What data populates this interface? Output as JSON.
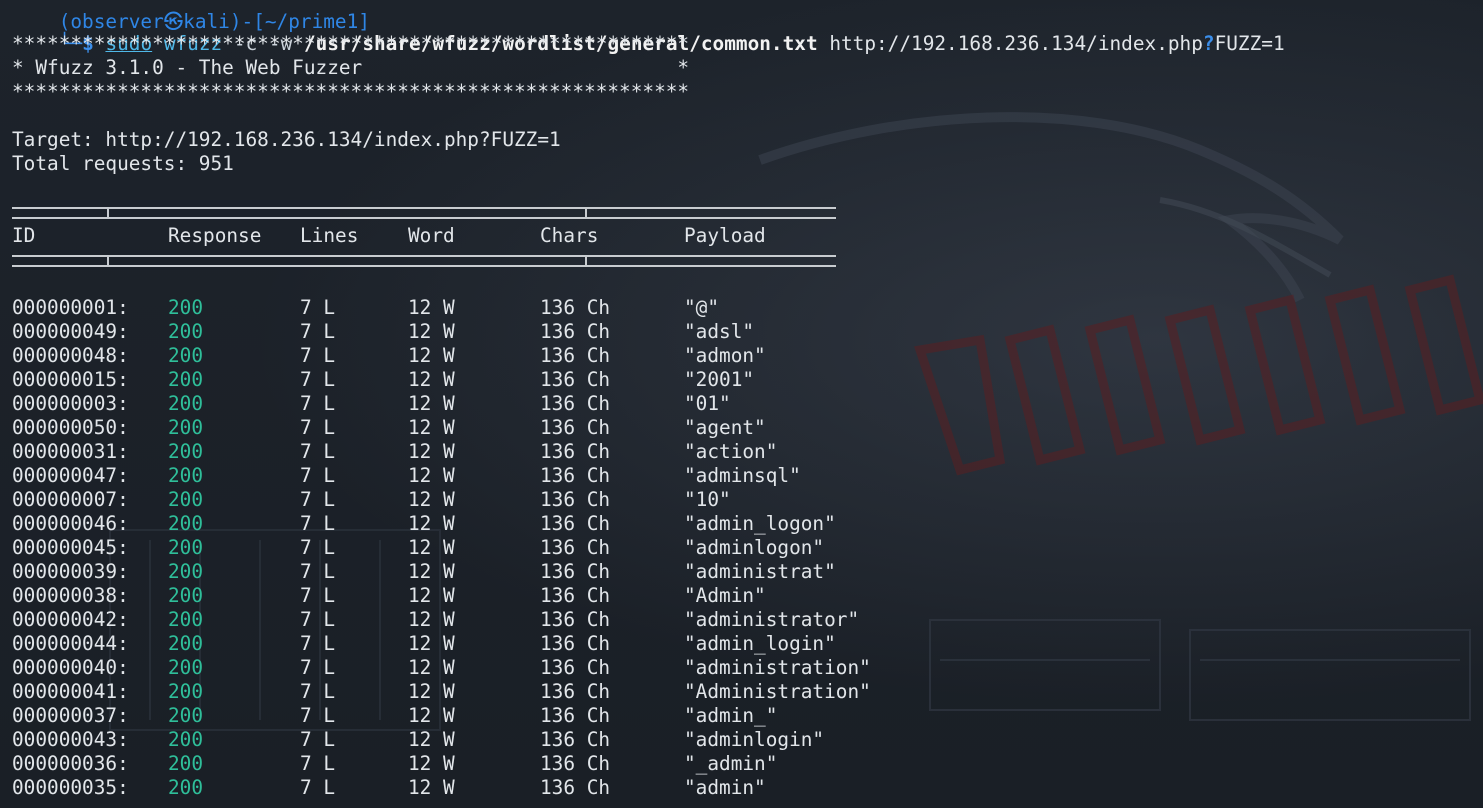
{
  "prompt": {
    "top_fragment": "(observer㉿kali)-[~/prime1]",
    "glyph": "└─",
    "dollar": "$"
  },
  "command": {
    "sudo": "sudo",
    "tool": "wfuzz",
    "flags": "-c -w",
    "wordlist": "/usr/share/wfuzz/wordlist/general/common.txt",
    "url_base": "http://192.168.236.134/index.php",
    "url_q": "?",
    "url_param": "FUZZ=1"
  },
  "banner": {
    "stars": "**********************************************************",
    "title": "* Wfuzz 3.1.0 - The Web Fuzzer                           *"
  },
  "target_line": "Target: http://192.168.236.134/index.php?FUZZ=1",
  "total_line": "Total requests: 951",
  "columns": {
    "id": "ID",
    "response": "Response",
    "lines": "Lines",
    "word": "Word",
    "chars": "Chars",
    "payload": "Payload"
  },
  "colors": {
    "response_ok": "#2fbf9a",
    "prompt_blue": "#3b8eea"
  },
  "rows": [
    {
      "id": "000000001:",
      "response": "200",
      "lines": "7 L",
      "word": "12 W",
      "chars": "136 Ch",
      "payload": "\"@\""
    },
    {
      "id": "000000049:",
      "response": "200",
      "lines": "7 L",
      "word": "12 W",
      "chars": "136 Ch",
      "payload": "\"adsl\""
    },
    {
      "id": "000000048:",
      "response": "200",
      "lines": "7 L",
      "word": "12 W",
      "chars": "136 Ch",
      "payload": "\"admon\""
    },
    {
      "id": "000000015:",
      "response": "200",
      "lines": "7 L",
      "word": "12 W",
      "chars": "136 Ch",
      "payload": "\"2001\""
    },
    {
      "id": "000000003:",
      "response": "200",
      "lines": "7 L",
      "word": "12 W",
      "chars": "136 Ch",
      "payload": "\"01\""
    },
    {
      "id": "000000050:",
      "response": "200",
      "lines": "7 L",
      "word": "12 W",
      "chars": "136 Ch",
      "payload": "\"agent\""
    },
    {
      "id": "000000031:",
      "response": "200",
      "lines": "7 L",
      "word": "12 W",
      "chars": "136 Ch",
      "payload": "\"action\""
    },
    {
      "id": "000000047:",
      "response": "200",
      "lines": "7 L",
      "word": "12 W",
      "chars": "136 Ch",
      "payload": "\"adminsql\""
    },
    {
      "id": "000000007:",
      "response": "200",
      "lines": "7 L",
      "word": "12 W",
      "chars": "136 Ch",
      "payload": "\"10\""
    },
    {
      "id": "000000046:",
      "response": "200",
      "lines": "7 L",
      "word": "12 W",
      "chars": "136 Ch",
      "payload": "\"admin_logon\""
    },
    {
      "id": "000000045:",
      "response": "200",
      "lines": "7 L",
      "word": "12 W",
      "chars": "136 Ch",
      "payload": "\"adminlogon\""
    },
    {
      "id": "000000039:",
      "response": "200",
      "lines": "7 L",
      "word": "12 W",
      "chars": "136 Ch",
      "payload": "\"administrat\""
    },
    {
      "id": "000000038:",
      "response": "200",
      "lines": "7 L",
      "word": "12 W",
      "chars": "136 Ch",
      "payload": "\"Admin\""
    },
    {
      "id": "000000042:",
      "response": "200",
      "lines": "7 L",
      "word": "12 W",
      "chars": "136 Ch",
      "payload": "\"administrator\""
    },
    {
      "id": "000000044:",
      "response": "200",
      "lines": "7 L",
      "word": "12 W",
      "chars": "136 Ch",
      "payload": "\"admin_login\""
    },
    {
      "id": "000000040:",
      "response": "200",
      "lines": "7 L",
      "word": "12 W",
      "chars": "136 Ch",
      "payload": "\"administration\""
    },
    {
      "id": "000000041:",
      "response": "200",
      "lines": "7 L",
      "word": "12 W",
      "chars": "136 Ch",
      "payload": "\"Administration\""
    },
    {
      "id": "000000037:",
      "response": "200",
      "lines": "7 L",
      "word": "12 W",
      "chars": "136 Ch",
      "payload": "\"admin_\""
    },
    {
      "id": "000000043:",
      "response": "200",
      "lines": "7 L",
      "word": "12 W",
      "chars": "136 Ch",
      "payload": "\"adminlogin\""
    },
    {
      "id": "000000036:",
      "response": "200",
      "lines": "7 L",
      "word": "12 W",
      "chars": "136 Ch",
      "payload": "\"_admin\""
    },
    {
      "id": "000000035:",
      "response": "200",
      "lines": "7 L",
      "word": "12 W",
      "chars": "136 Ch",
      "payload": "\"admin\""
    }
  ]
}
